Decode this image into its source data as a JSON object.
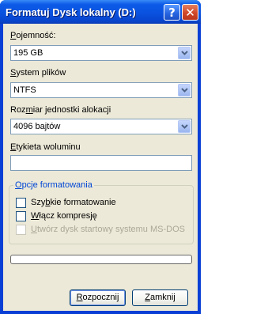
{
  "window": {
    "title": "Formatuj Dysk lokalny (D:)",
    "help_glyph": "?",
    "close_glyph": "✕"
  },
  "capacity": {
    "label_key": "P",
    "label_rest": "ojemność:",
    "value": "195 GB"
  },
  "filesystem": {
    "label_key": "S",
    "label_rest": "ystem plików",
    "value": "NTFS"
  },
  "allocation": {
    "label_pre": "Roz",
    "label_key": "m",
    "label_rest": "iar jednostki alokacji",
    "value": "4096 bajtów"
  },
  "volume": {
    "label_key": "E",
    "label_rest": "tykieta woluminu",
    "value": ""
  },
  "format_options": {
    "title_key": "O",
    "title_rest": "pcje formatowania",
    "quick": {
      "pre": "Szy",
      "key": "b",
      "rest": "kie formatowanie",
      "checked": false
    },
    "compress": {
      "pre": "",
      "key": "W",
      "rest": "łącz kompresję",
      "checked": false
    },
    "startup": {
      "pre": "",
      "key": "U",
      "rest": "twórz dysk startowy systemu MS-DOS",
      "checked": false,
      "enabled": false
    }
  },
  "progress": {
    "value": 0
  },
  "buttons": {
    "start": {
      "key": "R",
      "rest": "ozpocznij"
    },
    "close": {
      "key": "Z",
      "rest": "amknij"
    }
  },
  "colors": {
    "titlebar": "#0a52e0",
    "dialog_bg": "#ece9d8",
    "group_title": "#0046d5"
  }
}
